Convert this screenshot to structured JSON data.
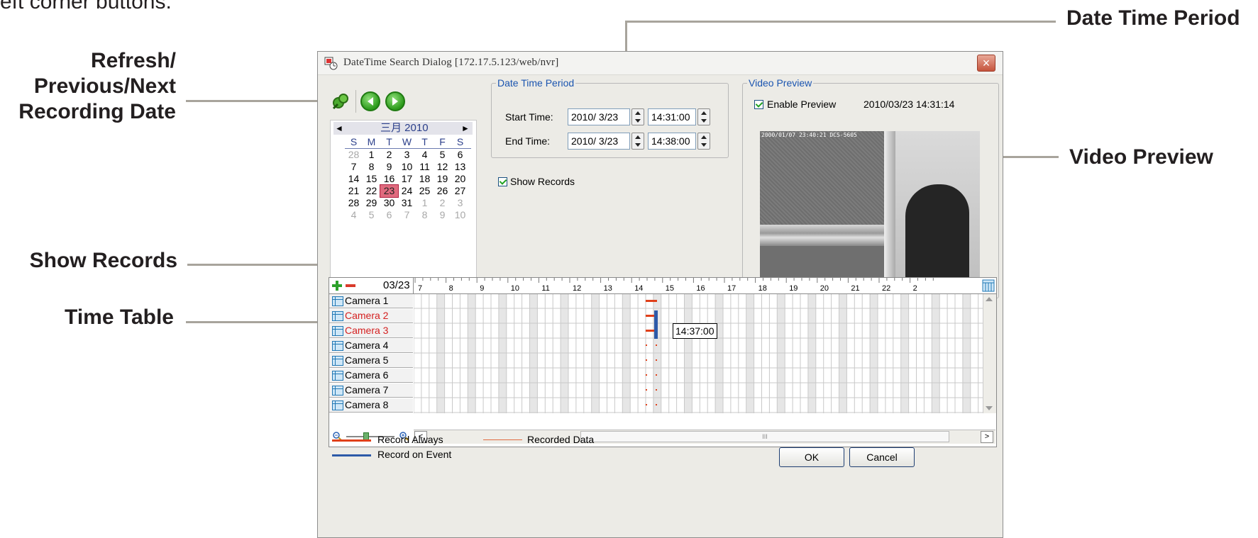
{
  "intro_fragment": "eft corner buttons.",
  "callouts": {
    "refresh_nav": [
      "Refresh/",
      "Previous/Next",
      "Recording Date"
    ],
    "date_time_period": "Date Time Period",
    "show_records": "Show Records",
    "time_table": "Time Table",
    "video_preview": "Video Preview"
  },
  "dialog": {
    "title": "DateTime Search Dialog  [172.17.5.123/web/nvr]",
    "close_glyph": "×"
  },
  "calendar": {
    "prev_glyph": "◄",
    "next_glyph": "►",
    "month_label": "三月 2010",
    "weekdays": [
      "S",
      "M",
      "T",
      "W",
      "T",
      "F",
      "S"
    ],
    "weeks": [
      [
        "28",
        "1",
        "2",
        "3",
        "4",
        "5",
        "6"
      ],
      [
        "7",
        "8",
        "9",
        "10",
        "11",
        "12",
        "13"
      ],
      [
        "14",
        "15",
        "16",
        "17",
        "18",
        "19",
        "20"
      ],
      [
        "21",
        "22",
        "23",
        "24",
        "25",
        "26",
        "27"
      ],
      [
        "28",
        "29",
        "30",
        "31",
        "1",
        "2",
        "3"
      ],
      [
        "4",
        "5",
        "6",
        "7",
        "8",
        "9",
        "10"
      ]
    ],
    "selected_day": "23"
  },
  "date_time_period": {
    "legend": "Date Time Period",
    "start_label": "Start Time:",
    "start_date": "2010/  3/23",
    "start_time": "14:31:00",
    "end_label": "End Time:",
    "end_date": "2010/  3/23",
    "end_time": "14:38:00"
  },
  "show_records": {
    "label": "Show Records",
    "checked": true
  },
  "video_preview": {
    "legend": "Video Preview",
    "enable_label": "Enable Preview",
    "enabled": true,
    "timestamp": "2010/03/23 14:31:14",
    "overlay_text": "2000/01/07 23:40:21 DCS-5605"
  },
  "time_table": {
    "date_label": "03/23",
    "hours": [
      "7",
      "8",
      "9",
      "10",
      "11",
      "12",
      "13",
      "14",
      "15",
      "16",
      "17",
      "18",
      "19",
      "20",
      "21",
      "22",
      "2"
    ],
    "cameras": [
      {
        "label": "Camera 1",
        "highlight": false
      },
      {
        "label": "Camera 2",
        "highlight": true
      },
      {
        "label": "Camera 3",
        "highlight": true
      },
      {
        "label": "Camera 4",
        "highlight": false
      },
      {
        "label": "Camera 5",
        "highlight": false
      },
      {
        "label": "Camera 6",
        "highlight": false
      },
      {
        "label": "Camera 7",
        "highlight": false
      },
      {
        "label": "Camera 8",
        "highlight": false
      }
    ],
    "tooltip": "14:37:00",
    "scroll_thumb_glyph": "III",
    "scroll_left_glyph": "<",
    "scroll_right_glyph": ">"
  },
  "legend_items": {
    "record_always": "Record Always",
    "recorded_data": "Recorded Data",
    "record_on_event": "Record on Event"
  },
  "buttons": {
    "ok": "OK",
    "cancel": "Cancel"
  },
  "colors": {
    "record_always": "#e0401a",
    "recorded_data": "#e06a40",
    "record_on_event": "#2d5aa8",
    "callout_line": "#a8a49c",
    "highlight_camera_text": "#d42020"
  }
}
